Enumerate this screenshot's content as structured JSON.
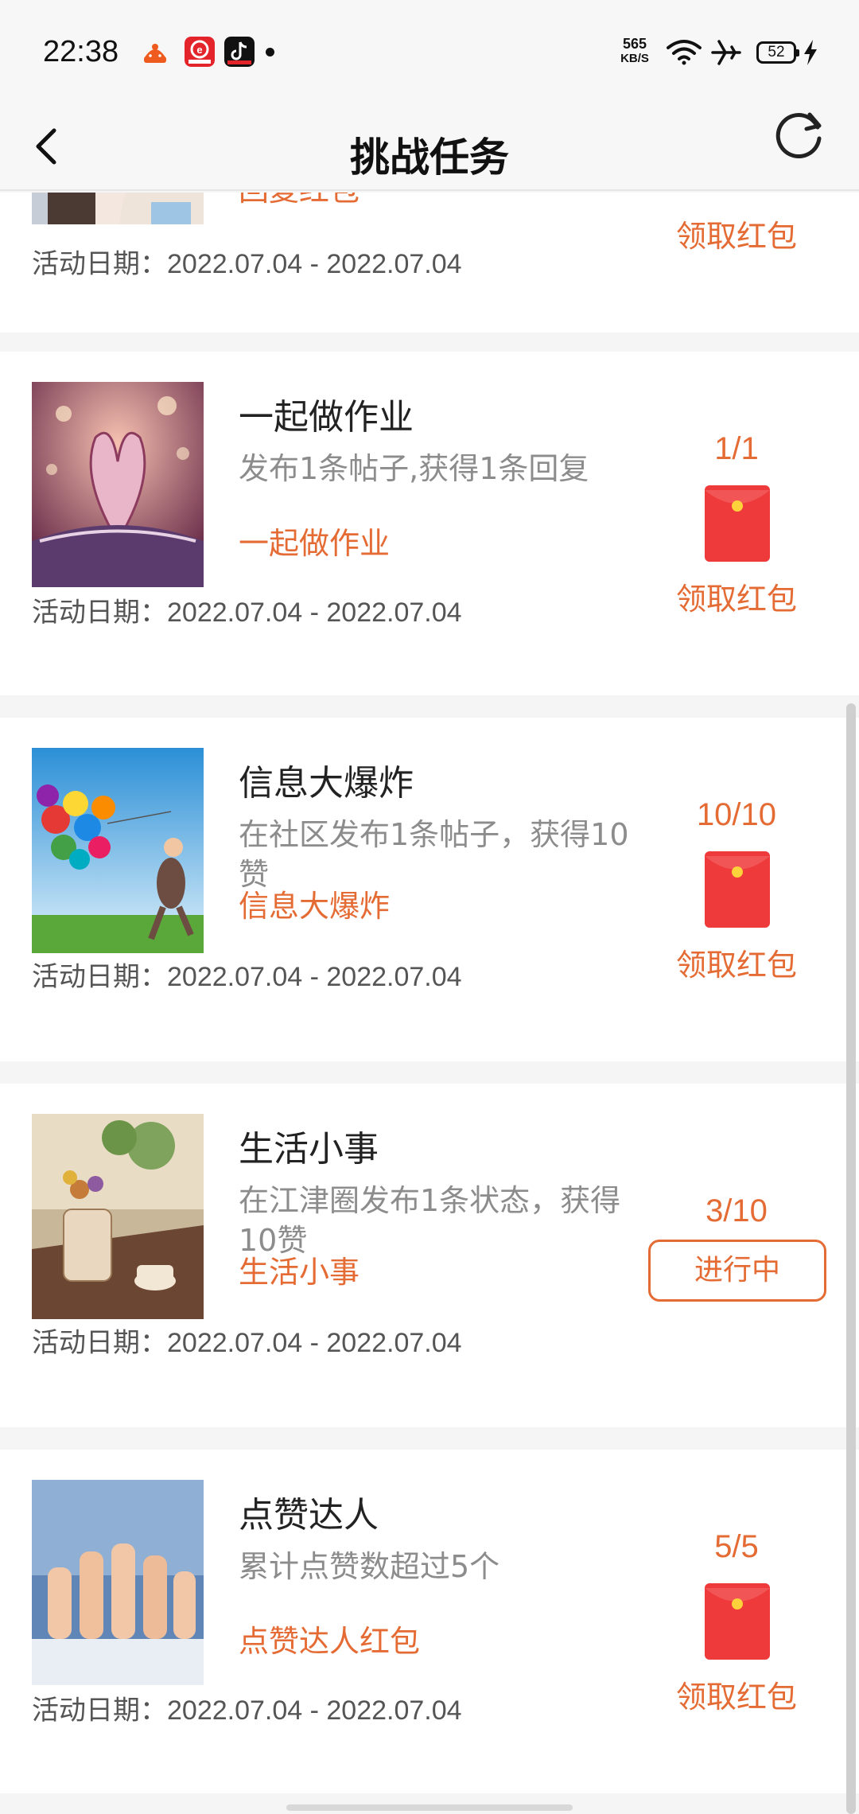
{
  "status_bar": {
    "time": "22:38",
    "net_speed_value": "565",
    "net_speed_unit": "KB/S",
    "battery": "52",
    "icons": [
      "taobao-app-icon",
      "news-app-icon",
      "tiktok-app-icon",
      "wifi-icon",
      "airplane-mode-icon",
      "charging-icon"
    ]
  },
  "header": {
    "title": "挑战任务",
    "back_icon": "chevron-left-icon",
    "refresh_icon": "refresh-icon"
  },
  "colors": {
    "accent": "#e56b34",
    "red_packet": "#ee3a3a",
    "red_packet_seal": "#ffd23c"
  },
  "tasks": [
    {
      "title": "",
      "description": "",
      "reward_name": "回复红包",
      "date_label": "活动日期：2022.07.04 - 2022.07.04",
      "progress": "",
      "action": "领取红包",
      "action_type": "claim",
      "image": "two-women-photo"
    },
    {
      "title": "一起做作业",
      "description": "发布1条帖子,获得1条回复",
      "reward_name": "一起做作业",
      "date_label": "活动日期：2022.07.04 - 2022.07.04",
      "progress": "1/1",
      "action": "领取红包",
      "action_type": "claim",
      "image": "book-heart-photo"
    },
    {
      "title": "信息大爆炸",
      "description": "在社区发布1条帖子，获得10赞",
      "reward_name": "信息大爆炸",
      "date_label": "活动日期：2022.07.04 - 2022.07.04",
      "progress": "10/10",
      "action": "领取红包",
      "action_type": "claim",
      "image": "balloons-photo"
    },
    {
      "title": "生活小事",
      "description": "在江津圈发布1条状态，获得10赞",
      "reward_name": "生活小事",
      "date_label": "活动日期：2022.07.04 - 2022.07.04",
      "progress": "3/10",
      "action": "进行中",
      "action_type": "in-progress",
      "image": "flowers-coffee-photo"
    },
    {
      "title": "点赞达人",
      "description": "累计点赞数超过5个",
      "reward_name": "点赞达人红包",
      "date_label": "活动日期：2022.07.04 - 2022.07.04",
      "progress": "5/5",
      "action": "领取红包",
      "action_type": "claim",
      "image": "thumbs-up-photo"
    }
  ]
}
